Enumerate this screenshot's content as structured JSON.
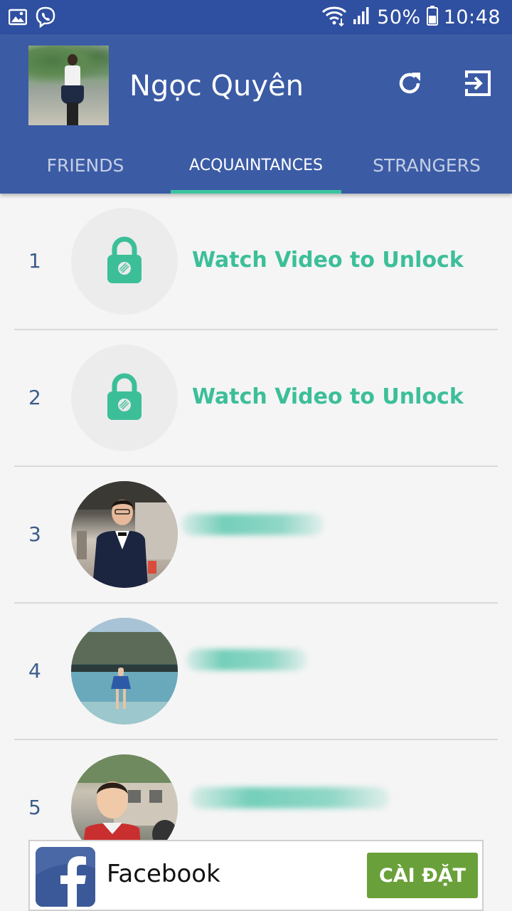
{
  "status_bar": {
    "battery": "50%",
    "time": "10:48",
    "icons": [
      "image-icon",
      "viber-icon",
      "wifi-icon",
      "signal-icon",
      "battery-icon"
    ]
  },
  "header": {
    "profile_name": "Ngọc Quyên",
    "actions": [
      "refresh-icon",
      "logout-icon"
    ]
  },
  "tabs": [
    {
      "label": "FRIENDS",
      "active": false
    },
    {
      "label": "ACQUAINTANCES",
      "active": true
    },
    {
      "label": "STRANGERS",
      "active": false
    }
  ],
  "list": {
    "rows": [
      {
        "rank": "1",
        "locked": true,
        "text": "Watch Video to Unlock"
      },
      {
        "rank": "2",
        "locked": true,
        "text": "Watch Video to Unlock"
      },
      {
        "rank": "3",
        "locked": false
      },
      {
        "rank": "4",
        "locked": false
      },
      {
        "rank": "5",
        "locked": false
      }
    ]
  },
  "ad": {
    "app_name": "Facebook",
    "cta_label": "CÀI ĐẶT"
  },
  "colors": {
    "status_bar": "#2f4fa0",
    "app_bar": "#3b5ba5",
    "accent": "#3cbf99",
    "cta": "#6aa039"
  }
}
